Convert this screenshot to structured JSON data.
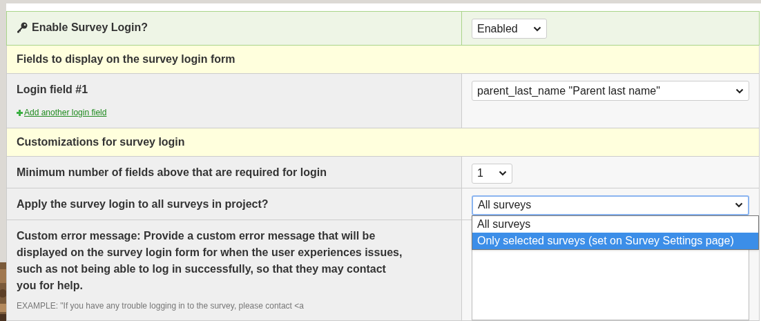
{
  "rows": [
    {
      "kind": "toggle",
      "label": "Enable Survey Login?",
      "control": {
        "kind": "select",
        "value": "Enabled",
        "full_width": false,
        "focused": false
      }
    },
    {
      "kind": "section",
      "label": "Fields to display on the survey login form"
    },
    {
      "kind": "setting",
      "label": "Login field #1",
      "link": "Add another login field",
      "control": {
        "kind": "select",
        "value": "parent_last_name \"Parent last name\"",
        "full_width": true,
        "focused": false
      }
    },
    {
      "kind": "section",
      "label": "Customizations for survey login"
    },
    {
      "kind": "setting",
      "label": "Minimum number of fields above that are required for login",
      "control": {
        "kind": "select",
        "value": "1",
        "full_width": false,
        "focused": false
      }
    },
    {
      "kind": "setting",
      "label": "Apply the survey login to all surveys in project?",
      "control": {
        "kind": "select",
        "value": "All surveys",
        "full_width": true,
        "focused": true,
        "options": [
          {
            "label": "All surveys",
            "highlighted": false
          },
          {
            "label": "Only selected surveys (set on Survey Settings page)",
            "highlighted": true
          }
        ]
      }
    },
    {
      "kind": "setting",
      "label": "Custom error message: Provide a custom error message that will be displayed on the survey login form for when the user experiences issues, such as not being able to log in successfully, so that they may contact you for help.",
      "note": "EXAMPLE: \"If you have any trouble logging in to the survey, please contact <a",
      "control": {
        "kind": "textarea"
      }
    }
  ]
}
